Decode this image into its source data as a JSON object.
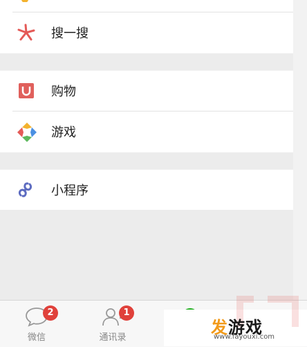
{
  "menu": {
    "group1": [
      {
        "label": "搜一搜",
        "icon": "search-spark-icon"
      }
    ],
    "group2": [
      {
        "label": "购物",
        "icon": "shopping-bag-icon"
      },
      {
        "label": "游戏",
        "icon": "game-diamond-icon"
      }
    ],
    "group3": [
      {
        "label": "小程序",
        "icon": "mini-program-icon"
      }
    ]
  },
  "tabbar": {
    "tabs": [
      {
        "label": "微信",
        "badge": "2",
        "icon": "chat-bubble-icon"
      },
      {
        "label": "通讯录",
        "badge": "1",
        "icon": "contacts-icon"
      }
    ]
  },
  "watermark": {
    "title_highlight": "发",
    "title_rest": "游戏",
    "url": "www.fayouxi.com"
  },
  "colors": {
    "badge": "#e0413b",
    "shopping_icon": "#e0605c",
    "search_icon": "#e45a57",
    "mini_program_icon": "#5c6bc0",
    "background": "#ececec"
  }
}
